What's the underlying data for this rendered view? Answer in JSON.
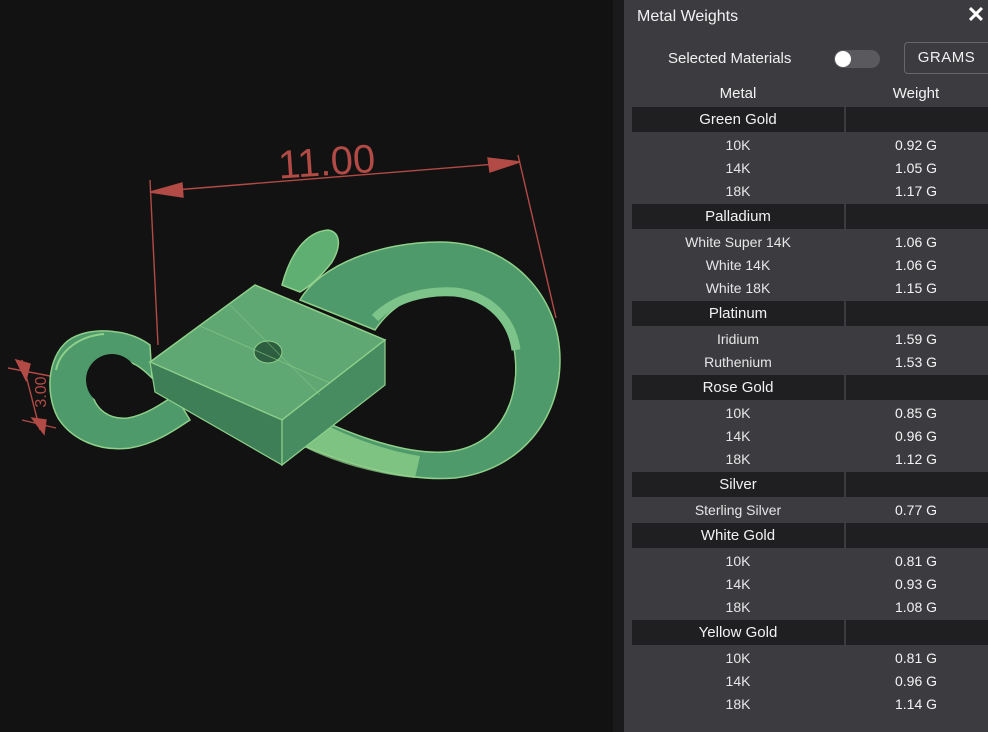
{
  "viewport": {
    "dimension_label": "11.00",
    "small_dimension_label": "3.00"
  },
  "panel": {
    "title": "Metal Weights",
    "close_icon": "close-icon",
    "selected_materials_label": "Selected Materials",
    "selected_materials_on": false,
    "units_button": "GRAMS",
    "col_metal": "Metal",
    "col_weight": "Weight",
    "groups": [
      {
        "name": "Green Gold",
        "rows": [
          {
            "metal": "10K",
            "weight": "0.92 G"
          },
          {
            "metal": "14K",
            "weight": "1.05 G"
          },
          {
            "metal": "18K",
            "weight": "1.17 G"
          }
        ]
      },
      {
        "name": "Palladium",
        "rows": [
          {
            "metal": "White Super 14K",
            "weight": "1.06 G"
          },
          {
            "metal": "White 14K",
            "weight": "1.06 G"
          },
          {
            "metal": "White 18K",
            "weight": "1.15 G"
          }
        ]
      },
      {
        "name": "Platinum",
        "rows": [
          {
            "metal": "Iridium",
            "weight": "1.59 G"
          },
          {
            "metal": "Ruthenium",
            "weight": "1.53 G"
          }
        ]
      },
      {
        "name": "Rose Gold",
        "rows": [
          {
            "metal": "10K",
            "weight": "0.85 G"
          },
          {
            "metal": "14K",
            "weight": "0.96 G"
          },
          {
            "metal": "18K",
            "weight": "1.12 G"
          }
        ]
      },
      {
        "name": "Silver",
        "rows": [
          {
            "metal": "Sterling Silver",
            "weight": "0.77 G"
          }
        ]
      },
      {
        "name": "White Gold",
        "rows": [
          {
            "metal": "10K",
            "weight": "0.81 G"
          },
          {
            "metal": "14K",
            "weight": "0.93 G"
          },
          {
            "metal": "18K",
            "weight": "1.08 G"
          }
        ]
      },
      {
        "name": "Yellow Gold",
        "rows": [
          {
            "metal": "10K",
            "weight": "0.81 G"
          },
          {
            "metal": "14K",
            "weight": "0.96 G"
          },
          {
            "metal": "18K",
            "weight": "1.14 G"
          }
        ]
      }
    ]
  },
  "colors": {
    "model_fill": "#4f9a6b",
    "model_highlight": "#8fd08a",
    "dimension_line": "#b24a45",
    "panel_bg": "#3c3c40",
    "group_bg": "#1f1f22"
  }
}
